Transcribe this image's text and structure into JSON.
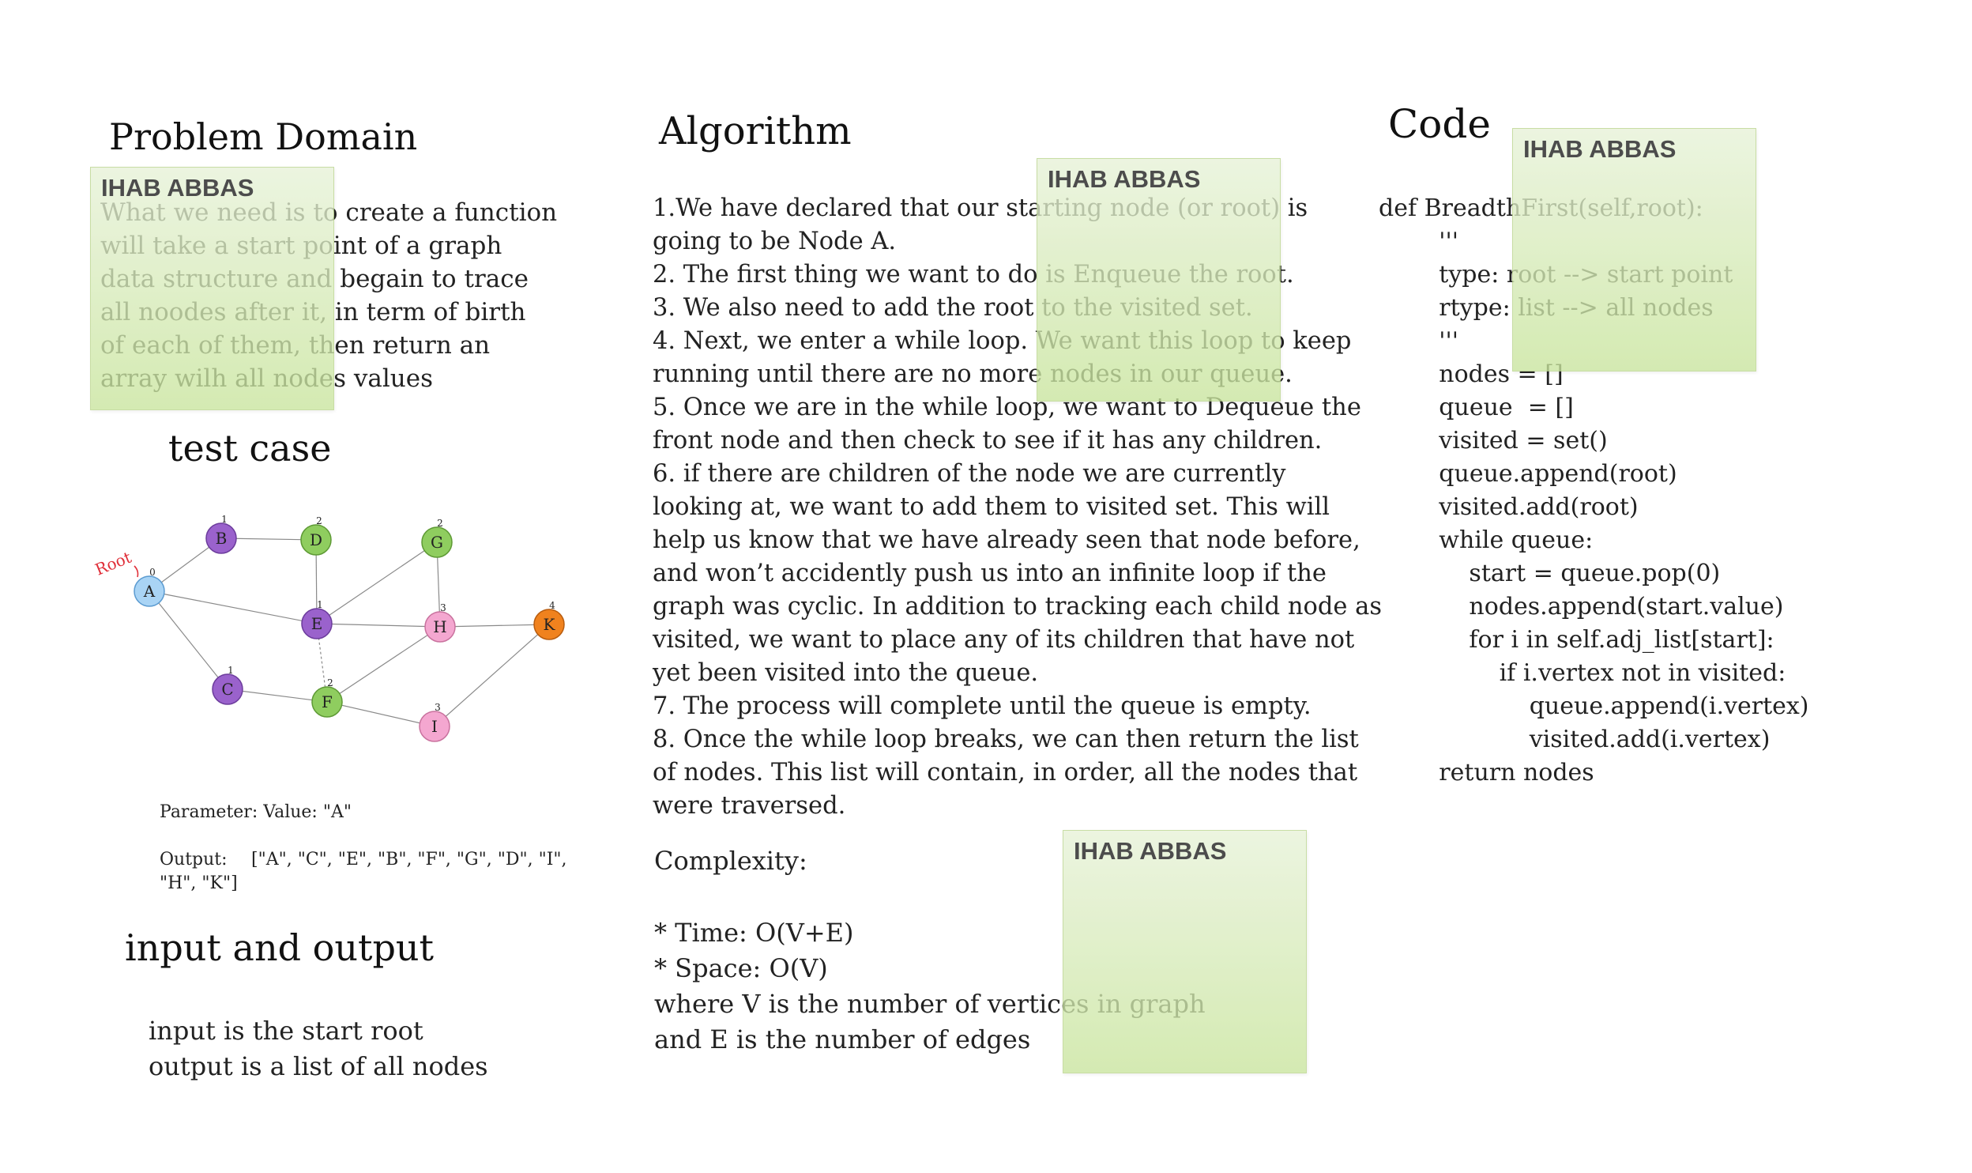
{
  "problem_domain": {
    "title": "Problem Domain",
    "lines": [
      "What we need is to create a function",
      "will take a start point of a graph",
      "data structure and begain to trace",
      "all noodes after it, in term of birth",
      "of each of them, then return an",
      "array wilh all nodes values"
    ]
  },
  "test_case": {
    "title": "test case",
    "root_label": "Root",
    "nodes": [
      {
        "id": "A",
        "level": "0",
        "color": "#a9d4f5"
      },
      {
        "id": "B",
        "level": "1",
        "color": "#9a62cc"
      },
      {
        "id": "C",
        "level": "1",
        "color": "#9a62cc"
      },
      {
        "id": "E",
        "level": "1",
        "color": "#9a62cc"
      },
      {
        "id": "D",
        "level": "2",
        "color": "#8fcd5f"
      },
      {
        "id": "F",
        "level": "2",
        "color": "#8fcd5f"
      },
      {
        "id": "G",
        "level": "2",
        "color": "#8fcd5f"
      },
      {
        "id": "H",
        "level": "3",
        "color": "#f4a7d0"
      },
      {
        "id": "I",
        "level": "3",
        "color": "#f4a7d0"
      },
      {
        "id": "K",
        "level": "4",
        "color": "#f0821e"
      }
    ],
    "parameter": "Parameter: Value: \"A\"",
    "output_label": "Output:",
    "output_line1": "[\"A\", \"C\", \"E\", \"B\", \"F\", \"G\", \"D\", \"I\",",
    "output_line2": "\"H\", \"K\"]"
  },
  "io": {
    "title": "input and output",
    "lines": [
      "input is the start root",
      "output is a list of all nodes"
    ]
  },
  "algorithm": {
    "title": "Algorithm",
    "lines": [
      "1.We have declared that our starting node (or root) is",
      "going to be Node A.",
      "2. The first thing we want to do is Enqueue the root.",
      "3. We also need to add the root to the visited set.",
      "4. Next, we enter a while loop. We want this loop to keep",
      "running until there are no more nodes in our queue.",
      "5. Once we are in the while loop, we want to Dequeue the",
      "front node and then check to see if it has any children.",
      "6. if there are children of the node we are currently",
      "looking at, we want to add them to visited set. This will",
      "help us know that we have already seen that node before,",
      "and won’t accidently push us into an infinite loop if the",
      "graph was cyclic. In addition to tracking each child node as",
      "visited, we want to place any of its children that have not",
      "yet been visited into the queue.",
      "7. The process will complete until the queue is empty.",
      "8. Once the while loop breaks, we can then return the list",
      "of nodes. This list will contain, in order, all the nodes that",
      "were traversed."
    ],
    "complexity_title": "Complexity:",
    "complexity_lines": [
      "* Time: O(V+E)",
      "* Space: O(V)",
      "where V is the number of vertices in graph",
      "and E is the number of edges"
    ]
  },
  "code": {
    "title": "Code",
    "lines": [
      "def BreadthFirst(self,root):",
      "        '''",
      "        type: root --> start point",
      "        rtype: list --> all nodes",
      "        '''",
      "        nodes = []",
      "        queue  = []",
      "        visited = set()",
      "        queue.append(root)",
      "        visited.add(root)",
      "        while queue:",
      "            start = queue.pop(0)",
      "            nodes.append(start.value)",
      "",
      "            for i in self.adj_list[start]:",
      "                if i.vertex not in visited:",
      "                    queue.append(i.vertex)",
      "                    visited.add(i.vertex)",
      "",
      "        return nodes"
    ]
  },
  "stickies": {
    "author": "IHAB ABBAS"
  }
}
